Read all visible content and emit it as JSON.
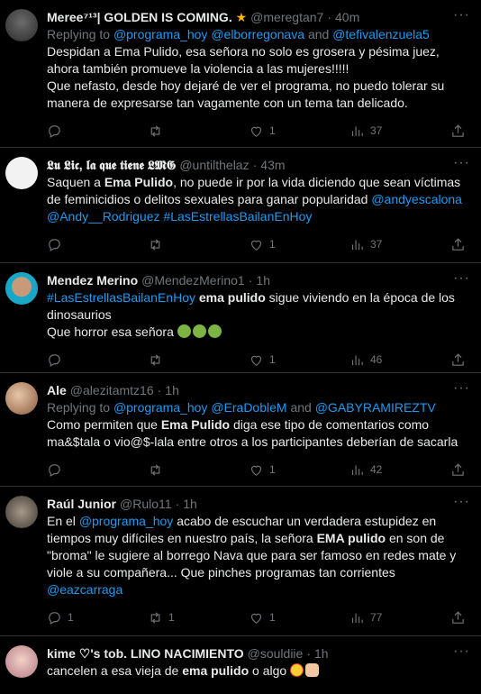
{
  "colors": {
    "background": "#000000",
    "text": "#e7e9ea",
    "muted": "#71767b",
    "link": "#1d9bf0",
    "divider": "#2f3336"
  },
  "tweets": [
    {
      "name": "Meree⁷¹³| 𝙶𝙾𝙻𝙳𝙴𝙽 𝙸𝚂 𝙲𝙾𝙼𝙸𝙽𝙶.",
      "name_plain": "Meree⁷¹³| GOLDEN IS COMING.",
      "handle": "@meregtan7",
      "time": "40m",
      "replying_label": "Replying to",
      "replying_to": [
        "@programa_hoy",
        "@elborregonava",
        "@tefivalenzuela5"
      ],
      "and_label": "and",
      "text_lines": [
        "Despidan a Ema Pulido, esa señora no solo es grosera y pésima juez, ahora también promueve la violencia a las mujeres!!!!!",
        "Que nefasto, desde hoy dejaré de ver el programa, no puedo tolerar su manera de expresarse tan vagamente con un tema tan delicado."
      ],
      "counts": {
        "reply": "",
        "retweet": "",
        "like": "1",
        "views": "37"
      }
    },
    {
      "name": "𝕷𝖚 𝕷𝖎𝖈, 𝖑𝖆 𝖖𝖚𝖊 𝖙𝖎𝖊𝖓𝖊 𝕷𝕸𝕲",
      "handle": "@untilthelaz",
      "time": "43m",
      "text_pre": "Saquen a ",
      "text_bold": "Ema Pulido",
      "text_post": ", no puede ir por la vida diciendo que sean víctimas de feminicidios o delitos sexuales para ganar popularidad ",
      "links": [
        "@andyescalona",
        "@Andy__Rodriguez",
        "#LasEstrellasBailanEnHoy"
      ],
      "counts": {
        "reply": "",
        "retweet": "",
        "like": "1",
        "views": "37"
      }
    },
    {
      "name": "Mendez Merino",
      "handle": "@MendezMerino1",
      "time": "1h",
      "link": "#LasEstrellasBailanEnHoy",
      "text_bold": "ema pulido",
      "text_post": " sigue viviendo en la época de los dinosaurios",
      "text_line2": "Que horror esa señora",
      "counts": {
        "reply": "",
        "retweet": "",
        "like": "1",
        "views": "46"
      }
    },
    {
      "name": "Ale",
      "handle": "@alezitamtz16",
      "time": "1h",
      "replying_label": "Replying to",
      "replying_to": [
        "@programa_hoy",
        "@EraDobleM",
        "@GABYRAMIREZTV"
      ],
      "and_label": "and",
      "text_pre": "Como permiten que ",
      "text_bold": "Ema Pulido",
      "text_post": " diga ese tipo de comentarios como ma&$tala o vio@$-lala entre otros a los participantes deberían de sacarla",
      "counts": {
        "reply": "",
        "retweet": "",
        "like": "1",
        "views": "42"
      }
    },
    {
      "name": "Raúl Junior",
      "handle": "@Rulo11",
      "time": "1h",
      "text_pre": "En el ",
      "link1": "@programa_hoy",
      "text_mid": " acabo de escuchar un verdadera estupidez en tiempos muy difíciles en nuestro país, la señora ",
      "text_bold": "EMA pulido",
      "text_post": " en son de \"broma\" le sugiere al borrego Nava que para ser famoso en redes mate y viole a su compañera... Que pinches programas tan corrientes ",
      "link2": "@eazcarraga",
      "counts": {
        "reply": "1",
        "retweet": "1",
        "like": "1",
        "views": "77"
      }
    },
    {
      "name": "kime ♡'s tob. LINO NACIMIENTO",
      "handle": "@souldiie",
      "time": "1h",
      "text_pre": "cancelen a esa vieja de ",
      "text_bold": "ema pulido",
      "text_post": " o algo "
    }
  ],
  "icons": [
    "reply-icon",
    "retweet-icon",
    "like-icon",
    "views-icon",
    "share-icon",
    "more-icon"
  ]
}
